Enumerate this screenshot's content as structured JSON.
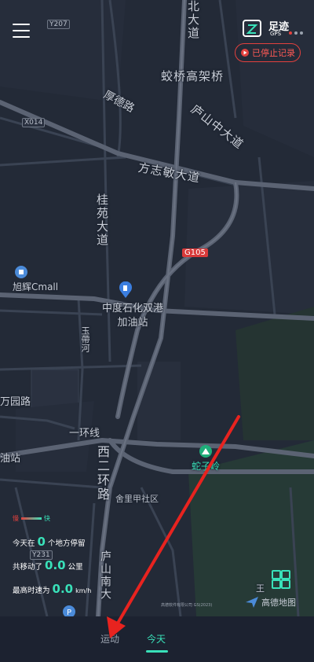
{
  "header": {
    "logo_text": "足迹",
    "logo_sub": "GPS",
    "record_label": "已停止记录"
  },
  "map": {
    "labels": {
      "beidadao": "北大道",
      "jiaoqiao": "蛟桥高架桥",
      "fangde": "厚德路",
      "lushanzhong": "庐山中大道",
      "fangzhimin": "方志敏大道",
      "guiyuan": "桂苑大道",
      "xuhui": "旭辉Cmall",
      "gas": "中度石化双港加油站",
      "yuqu": "玉帶河",
      "fuyuan": "万园路",
      "youzhan": "油站",
      "huanxian": "一环线",
      "xi_erhuan": "西二环路",
      "shezi": "蛇子岭",
      "jiali": "舍里甲社区",
      "lushannan": "庐山南大",
      "wang": "王"
    },
    "shields": {
      "y207": "Y207",
      "x014": "X014",
      "g105": "G105",
      "y231": "Y231"
    },
    "copyright": "高德软件有限公司 GS(2023)",
    "provider": "高德地图"
  },
  "legend": {
    "label": "快"
  },
  "stats": {
    "stop_prefix": "今天在",
    "stop_count": "0",
    "stop_suffix": "个地方停留",
    "move_prefix": "共移动了",
    "move_value": "0.0",
    "move_unit": "公里",
    "speed_prefix": "最高时速为",
    "speed_value": "0.0",
    "speed_unit": "km/h"
  },
  "tabs": {
    "sport": "运动",
    "today": "今天"
  },
  "colors": {
    "accent": "#39e1b9",
    "record_red": "#e3413e",
    "arrow_red": "#e8231f"
  }
}
